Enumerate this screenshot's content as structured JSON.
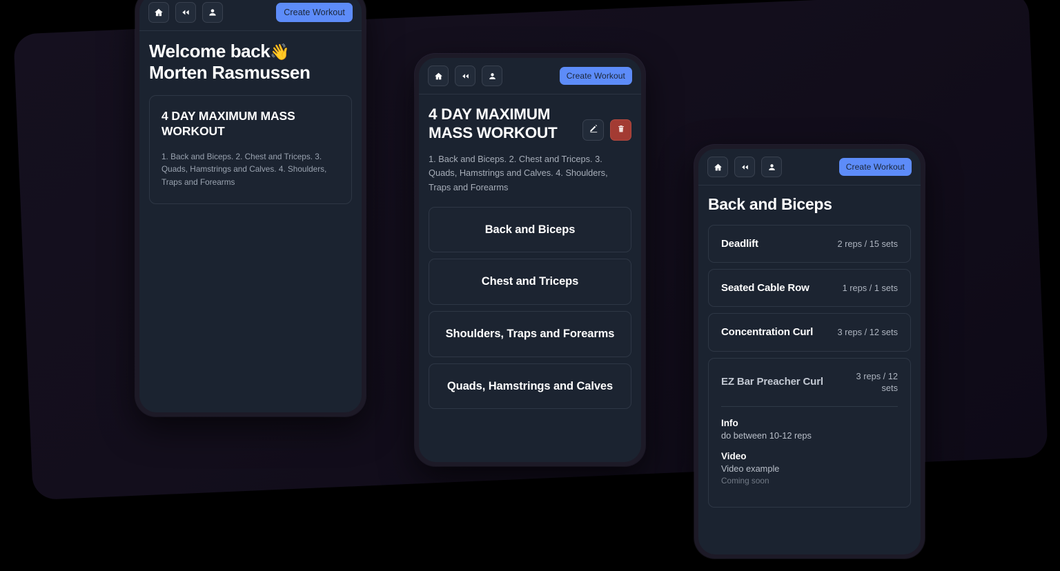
{
  "nav": {
    "home_icon": "home-icon",
    "rewind_icon": "rewind-icon",
    "profile_icon": "person-icon",
    "create_label": "Create Workout"
  },
  "phone1": {
    "welcome_line1": "Welcome back",
    "welcome_emoji": "👋",
    "welcome_line2": "Morten Rasmussen",
    "program": {
      "title": "4 DAY MAXIMUM MASS WORKOUT",
      "description": "1. Back and Biceps. 2. Chest and Triceps. 3. Quads, Hamstrings and Calves. 4. Shoulders, Traps and Forearms"
    }
  },
  "phone2": {
    "title": "4 DAY MAXIMUM MASS WORKOUT",
    "edit_icon": "pencil-icon",
    "delete_icon": "trash-icon",
    "description": "1. Back and Biceps. 2. Chest and Triceps. 3. Quads, Hamstrings and Calves. 4. Shoulders, Traps and Forearms",
    "days": [
      {
        "label": "Back and Biceps"
      },
      {
        "label": "Chest and Triceps"
      },
      {
        "label": "Shoulders, Traps and Forearms"
      },
      {
        "label": "Quads, Hamstrings and Calves"
      }
    ]
  },
  "phone3": {
    "title": "Back and Biceps",
    "exercises": [
      {
        "name": "Deadlift",
        "reps": "2 reps / 15 sets"
      },
      {
        "name": "Seated Cable Row",
        "reps": "1 reps / 1 sets"
      },
      {
        "name": "Concentration Curl",
        "reps": "3 reps / 12 sets"
      }
    ],
    "expanded": {
      "name": "EZ Bar Preacher Curl",
      "reps": "3 reps / 12 sets",
      "info_label": "Info",
      "info_value": "do between 10-12 reps",
      "video_label": "Video",
      "video_value": "Video example",
      "video_sub": "Coming soon"
    }
  },
  "colors": {
    "accent_blue": "#5d8cf9",
    "danger_red": "#a33b33",
    "screen_bg": "#1b2330",
    "card_bg": "#1c2431",
    "backdrop": "#15101f",
    "page_bg": "#000000"
  }
}
